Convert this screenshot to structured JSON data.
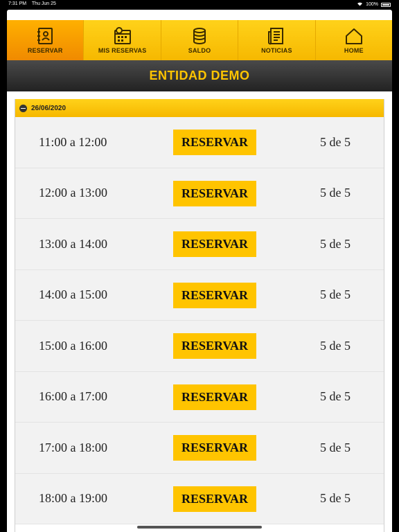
{
  "status_bar": {
    "time": "7:31 PM",
    "date": "Thu Jun 25",
    "battery": "100%"
  },
  "tabs": [
    {
      "label": "RESERVAR",
      "icon": "address-book-icon",
      "active": true
    },
    {
      "label": "MIS RESERVAS",
      "icon": "calendar-icon",
      "active": false
    },
    {
      "label": "SALDO",
      "icon": "coins-icon",
      "active": false
    },
    {
      "label": "NOTICIAS",
      "icon": "newspaper-icon",
      "active": false
    },
    {
      "label": "HOME",
      "icon": "home-icon",
      "active": false
    }
  ],
  "title": "ENTIDAD DEMO",
  "section": {
    "date": "26/06/2020",
    "slots": [
      {
        "time": "11:00 a 12:00",
        "button": "RESERVAR",
        "capacity": "5 de 5"
      },
      {
        "time": "12:00 a 13:00",
        "button": "RESERVAR",
        "capacity": "5 de 5"
      },
      {
        "time": "13:00 a 14:00",
        "button": "RESERVAR",
        "capacity": "5 de 5"
      },
      {
        "time": "14:00 a 15:00",
        "button": "RESERVAR",
        "capacity": "5 de 5"
      },
      {
        "time": "15:00 a 16:00",
        "button": "RESERVAR",
        "capacity": "5 de 5"
      },
      {
        "time": "16:00 a 17:00",
        "button": "RESERVAR",
        "capacity": "5 de 5"
      },
      {
        "time": "17:00 a 18:00",
        "button": "RESERVAR",
        "capacity": "5 de 5"
      },
      {
        "time": "18:00 a 19:00",
        "button": "RESERVAR",
        "capacity": "5 de 5"
      }
    ]
  },
  "colors": {
    "accent": "#ffc400",
    "tab_active": "#f59a00",
    "title_bg": "#333333"
  }
}
